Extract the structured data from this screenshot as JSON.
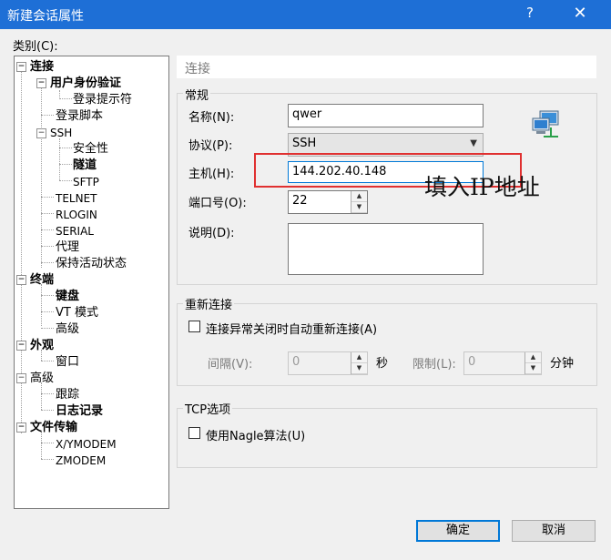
{
  "window": {
    "title": "新建会话属性",
    "help": "?",
    "close": "✕"
  },
  "category_label": "类别(C):",
  "tree": {
    "items": [
      {
        "label": "连接",
        "bold": true
      },
      {
        "label": "用户身份验证",
        "bold": true
      },
      {
        "label": "登录提示符",
        "bold": false
      },
      {
        "label": "登录脚本",
        "bold": false
      },
      {
        "label": "SSH",
        "bold": false
      },
      {
        "label": "安全性",
        "bold": false
      },
      {
        "label": "隧道",
        "bold": true
      },
      {
        "label": "SFTP",
        "bold": false
      },
      {
        "label": "TELNET",
        "bold": false
      },
      {
        "label": "RLOGIN",
        "bold": false
      },
      {
        "label": "SERIAL",
        "bold": false
      },
      {
        "label": "代理",
        "bold": false
      },
      {
        "label": "保持活动状态",
        "bold": false
      },
      {
        "label": "终端",
        "bold": true
      },
      {
        "label": "键盘",
        "bold": true
      },
      {
        "label": "VT 模式",
        "bold": false
      },
      {
        "label": "高级",
        "bold": false
      },
      {
        "label": "外观",
        "bold": true
      },
      {
        "label": "窗口",
        "bold": false
      },
      {
        "label": "高级",
        "bold": false
      },
      {
        "label": "跟踪",
        "bold": false
      },
      {
        "label": "日志记录",
        "bold": true
      },
      {
        "label": "文件传输",
        "bold": true
      },
      {
        "label": "X/YMODEM",
        "bold": false
      },
      {
        "label": "ZMODEM",
        "bold": false
      }
    ]
  },
  "section_header": "连接",
  "general": {
    "title": "常规",
    "name_label": "名称(N):",
    "name_value": "qwer",
    "protocol_label": "协议(P):",
    "protocol_value": "SSH",
    "host_label": "主机(H):",
    "host_value": "144.202.40.148",
    "port_label": "端口号(O):",
    "port_value": "22",
    "desc_label": "说明(D):",
    "desc_value": ""
  },
  "annotation": "填入IP地址",
  "reconnect": {
    "title": "重新连接",
    "checkbox_label": "连接异常关闭时自动重新连接(A)",
    "interval_label": "间隔(V):",
    "interval_value": "0",
    "sec": "秒",
    "limit_label": "限制(L):",
    "limit_value": "0",
    "min": "分钟"
  },
  "tcp": {
    "title": "TCP选项",
    "checkbox_label": "使用Nagle算法(U)"
  },
  "buttons": {
    "ok": "确定",
    "cancel": "取消"
  },
  "colors": {
    "titlebar": "#1e6fd6",
    "highlight": "#e03030",
    "accent": "#0078d7"
  }
}
